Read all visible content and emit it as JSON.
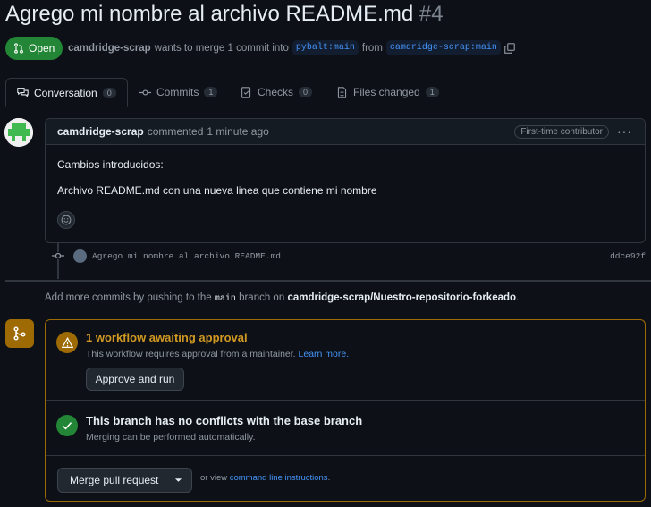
{
  "pr": {
    "title": "Agrego mi nombre al archivo README.md",
    "number": "#4",
    "state": "Open",
    "author": "camdridge-scrap",
    "meta_text": "wants to merge 1 commit into",
    "base_branch": "pybalt:main",
    "from_text": "from",
    "head_branch": "camdridge-scrap:main"
  },
  "tabs": [
    {
      "label": "Conversation",
      "count": "0",
      "icon": "comment-discussion-icon"
    },
    {
      "label": "Commits",
      "count": "1",
      "icon": "git-commit-icon"
    },
    {
      "label": "Checks",
      "count": "0",
      "icon": "checklist-icon"
    },
    {
      "label": "Files changed",
      "count": "1",
      "icon": "file-diff-icon"
    }
  ],
  "comment": {
    "author": "camdridge-scrap",
    "action": "commented",
    "time": "1 minute ago",
    "badge": "First-time contributor",
    "body_line1": "Cambios introducidos:",
    "body_line2": "Archivo README.md con una nueva linea que contiene mi nombre"
  },
  "commit": {
    "message": "Agrego mi nombre al archivo README.md",
    "sha": "ddce92f"
  },
  "add_commits": {
    "prefix": "Add more commits by pushing to the",
    "branch": "main",
    "mid": "branch on",
    "repo": "camdridge-scrap/Nuestro-repositorio-forkeado",
    "suffix": "."
  },
  "merge": {
    "workflow_title": "1 workflow awaiting approval",
    "workflow_sub": "This workflow requires approval from a maintainer.",
    "learn_more": "Learn more.",
    "approve_button": "Approve and run",
    "conflict_title": "This branch has no conflicts with the base branch",
    "conflict_sub": "Merging can be performed automatically.",
    "merge_button": "Merge pull request",
    "or_view": "or view",
    "cli_link": "command line instructions",
    "cli_suffix": "."
  },
  "colors": {
    "background": "#0d1117",
    "open_green": "#238636",
    "warning": "#d29922",
    "link": "#4493f8",
    "border": "#30363d"
  }
}
